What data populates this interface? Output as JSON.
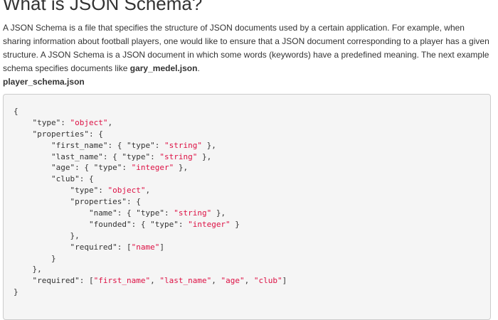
{
  "page": {
    "title": "What is JSON Schema?",
    "intro": {
      "before_link": "A JSON Schema is a file that specifies the structure of JSON documents used by a certain application. For example, when sharing information about football players, one would like to ensure that a JSON document corresponding to a player has a given structure. A JSON Schema is a JSON document in which some words (keywords) have a predefined meaning. The next example schema specifies documents like ",
      "bold_filename": "gary_medel.json",
      "after_link": "."
    },
    "file_label": "player_schema.json"
  },
  "code": {
    "lines": [
      [
        {
          "t": "p",
          "v": "{"
        }
      ],
      [
        {
          "t": "p",
          "v": "    "
        },
        {
          "t": "key",
          "v": "\"type\""
        },
        {
          "t": "p",
          "v": ": "
        },
        {
          "t": "str",
          "v": "\"object\""
        },
        {
          "t": "p",
          "v": ","
        }
      ],
      [
        {
          "t": "p",
          "v": "    "
        },
        {
          "t": "key",
          "v": "\"properties\""
        },
        {
          "t": "p",
          "v": ": {"
        }
      ],
      [
        {
          "t": "p",
          "v": "        "
        },
        {
          "t": "key",
          "v": "\"first_name\""
        },
        {
          "t": "p",
          "v": ": { "
        },
        {
          "t": "key",
          "v": "\"type\""
        },
        {
          "t": "p",
          "v": ": "
        },
        {
          "t": "str",
          "v": "\"string\""
        },
        {
          "t": "p",
          "v": " },"
        }
      ],
      [
        {
          "t": "p",
          "v": "        "
        },
        {
          "t": "key",
          "v": "\"last_name\""
        },
        {
          "t": "p",
          "v": ": { "
        },
        {
          "t": "key",
          "v": "\"type\""
        },
        {
          "t": "p",
          "v": ": "
        },
        {
          "t": "str",
          "v": "\"string\""
        },
        {
          "t": "p",
          "v": " },"
        }
      ],
      [
        {
          "t": "p",
          "v": "        "
        },
        {
          "t": "key",
          "v": "\"age\""
        },
        {
          "t": "p",
          "v": ": { "
        },
        {
          "t": "key",
          "v": "\"type\""
        },
        {
          "t": "p",
          "v": ": "
        },
        {
          "t": "str",
          "v": "\"integer\""
        },
        {
          "t": "p",
          "v": " },"
        }
      ],
      [
        {
          "t": "p",
          "v": "        "
        },
        {
          "t": "key",
          "v": "\"club\""
        },
        {
          "t": "p",
          "v": ": {"
        }
      ],
      [
        {
          "t": "p",
          "v": "            "
        },
        {
          "t": "key",
          "v": "\"type\""
        },
        {
          "t": "p",
          "v": ": "
        },
        {
          "t": "str",
          "v": "\"object\""
        },
        {
          "t": "p",
          "v": ","
        }
      ],
      [
        {
          "t": "p",
          "v": "            "
        },
        {
          "t": "key",
          "v": "\"properties\""
        },
        {
          "t": "p",
          "v": ": {"
        }
      ],
      [
        {
          "t": "p",
          "v": "                "
        },
        {
          "t": "key",
          "v": "\"name\""
        },
        {
          "t": "p",
          "v": ": { "
        },
        {
          "t": "key",
          "v": "\"type\""
        },
        {
          "t": "p",
          "v": ": "
        },
        {
          "t": "str",
          "v": "\"string\""
        },
        {
          "t": "p",
          "v": " },"
        }
      ],
      [
        {
          "t": "p",
          "v": "                "
        },
        {
          "t": "key",
          "v": "\"founded\""
        },
        {
          "t": "p",
          "v": ": { "
        },
        {
          "t": "key",
          "v": "\"type\""
        },
        {
          "t": "p",
          "v": ": "
        },
        {
          "t": "str",
          "v": "\"integer\""
        },
        {
          "t": "p",
          "v": " }"
        }
      ],
      [
        {
          "t": "p",
          "v": "            },"
        }
      ],
      [
        {
          "t": "p",
          "v": "            "
        },
        {
          "t": "key",
          "v": "\"required\""
        },
        {
          "t": "p",
          "v": ": ["
        },
        {
          "t": "str",
          "v": "\"name\""
        },
        {
          "t": "p",
          "v": "]"
        }
      ],
      [
        {
          "t": "p",
          "v": "        }"
        }
      ],
      [
        {
          "t": "p",
          "v": "    },"
        }
      ],
      [
        {
          "t": "p",
          "v": "    "
        },
        {
          "t": "key",
          "v": "\"required\""
        },
        {
          "t": "p",
          "v": ": ["
        },
        {
          "t": "str",
          "v": "\"first_name\""
        },
        {
          "t": "p",
          "v": ", "
        },
        {
          "t": "str",
          "v": "\"last_name\""
        },
        {
          "t": "p",
          "v": ", "
        },
        {
          "t": "str",
          "v": "\"age\""
        },
        {
          "t": "p",
          "v": ", "
        },
        {
          "t": "str",
          "v": "\"club\""
        },
        {
          "t": "p",
          "v": "]"
        }
      ],
      [
        {
          "t": "p",
          "v": "}"
        }
      ]
    ]
  },
  "colors": {
    "text": "#333333",
    "string_token": "#dd1144",
    "code_background": "#f5f5f5",
    "code_border": "#cccccc"
  }
}
